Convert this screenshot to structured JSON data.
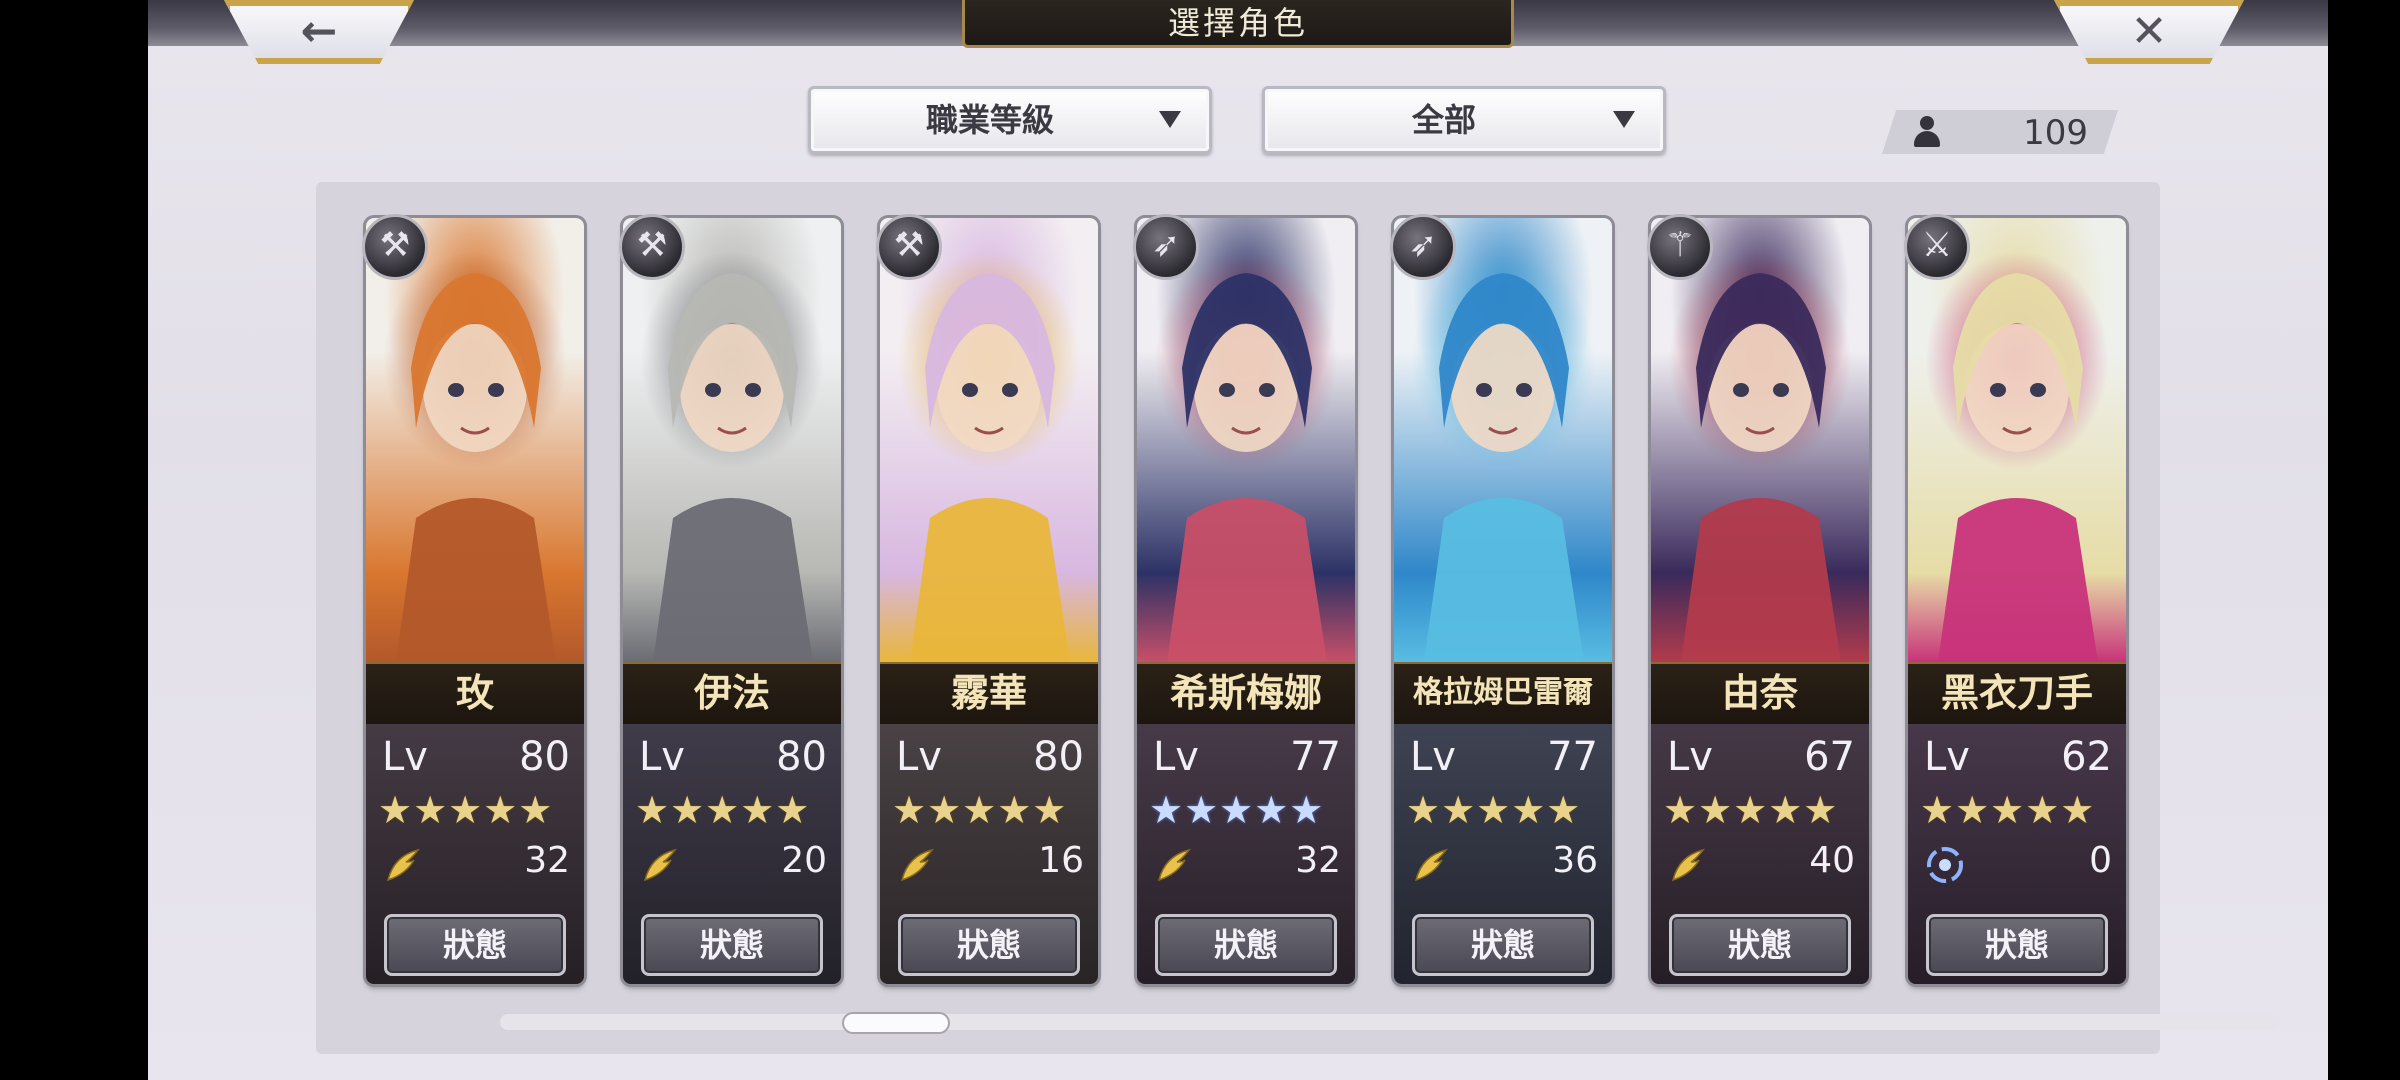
{
  "header": {
    "title": "選擇角色",
    "back_icon": "←",
    "close_icon": "✕"
  },
  "filters": {
    "sort_label": "職業等級",
    "category_label": "全部"
  },
  "roster": {
    "count": "109"
  },
  "status_label": "狀態",
  "level_label": "Lv",
  "characters": [
    {
      "name": "玫",
      "level": "80",
      "stars": "★★★★★",
      "star_color": "gold",
      "resource": "32",
      "resource_icon": "feather-icon",
      "class_icon": "hammer-icon",
      "palette": [
        "#f2efe9",
        "#d9772f",
        "#b3582a"
      ]
    },
    {
      "name": "伊法",
      "level": "80",
      "stars": "★★★★★",
      "star_color": "gold",
      "resource": "20",
      "resource_icon": "feather-icon",
      "class_icon": "hammer-icon",
      "palette": [
        "#eef0f1",
        "#b7b7b3",
        "#6a6c74"
      ]
    },
    {
      "name": "霧華",
      "level": "80",
      "stars": "★★★★★",
      "star_color": "gold",
      "resource": "16",
      "resource_icon": "feather-icon",
      "class_icon": "hammer-icon",
      "palette": [
        "#f3eef2",
        "#d8b7e0",
        "#e9b63b"
      ]
    },
    {
      "name": "希斯梅娜",
      "level": "77",
      "stars": "★★★★★",
      "star_color": "blue",
      "resource": "32",
      "resource_icon": "feather-icon",
      "class_icon": "spear-icon",
      "palette": [
        "#f0eef2",
        "#2c3266",
        "#c84f68"
      ]
    },
    {
      "name": "格拉姆巴雷爾",
      "level": "77",
      "stars": "★★★★★",
      "star_color": "gold",
      "resource": "36",
      "resource_icon": "feather-icon",
      "class_icon": "spear-icon",
      "palette": [
        "#eef2f6",
        "#2f87c9",
        "#59bde2"
      ]
    },
    {
      "name": "由奈",
      "level": "67",
      "stars": "★★★★★",
      "star_color": "gold",
      "resource": "40",
      "resource_icon": "feather-icon",
      "class_icon": "staff-icon",
      "palette": [
        "#f1eef3",
        "#3a2a5c",
        "#b23b4c"
      ]
    },
    {
      "name": "黑衣刀手",
      "level": "62",
      "stars": "★★★★★",
      "star_color": "gold",
      "resource": "0",
      "resource_icon": "swirl-icon",
      "class_icon": "blade-icon",
      "palette": [
        "#eef0ec",
        "#e6dca6",
        "#c8337a"
      ]
    }
  ]
}
